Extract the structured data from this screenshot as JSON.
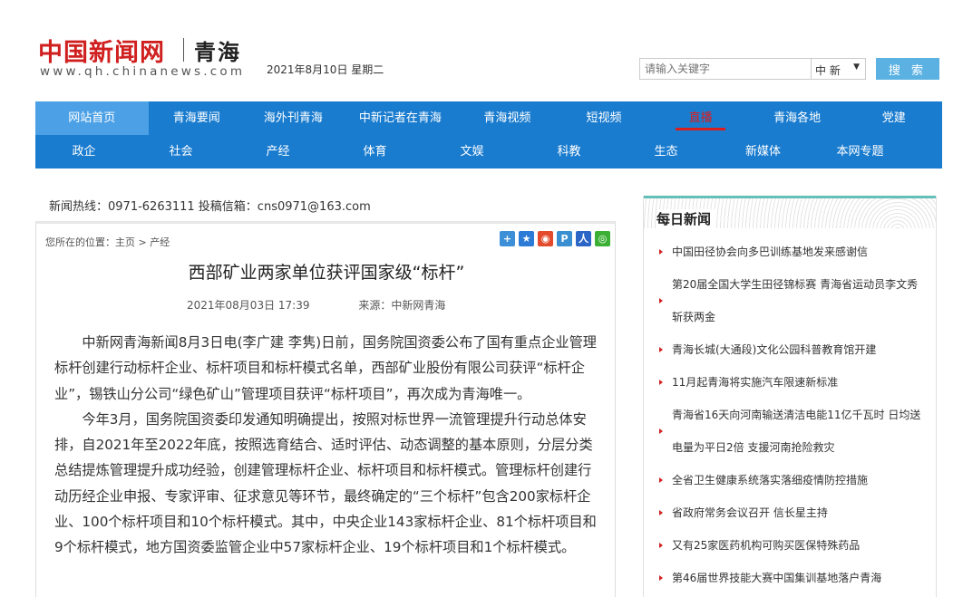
{
  "header": {
    "logo_cn": "中国新闻网",
    "logo_region": "青海",
    "logo_url": "www.qh.chinanews.com",
    "date": "2021年8月10日 星期二",
    "search_placeholder": "请输入关键字",
    "search_select": "中 新",
    "search_button": "搜 索"
  },
  "nav": {
    "row1": [
      "网站首页",
      "青海要闻",
      "海外刊青海",
      "中新记者在青海",
      "青海视频",
      "短视频",
      "直播",
      "青海各地",
      "党建"
    ],
    "row2": [
      "政企",
      "社会",
      "产经",
      "体育",
      "文娱",
      "科教",
      "生态",
      "新媒体",
      "本网专题"
    ]
  },
  "hotline": "新闻热线：0971-6263111 投稿信箱：cns0971@163.com",
  "article": {
    "breadcrumb": "您所在的位置：主页 > 产经",
    "title": "西部矿业两家单位获评国家级“标杆”",
    "datetime": "2021年08月03日 17:39",
    "source": "来源：中新网青海",
    "paragraphs": [
      "中新网青海新闻8月3日电(李广建 李隽)日前，国务院国资委公布了国有重点企业管理标杆创建行动标杆企业、标杆项目和标杆模式名单，西部矿业股份有限公司获评“标杆企业”，锡铁山分公司“绿色矿山”管理项目获评“标杆项目”，再次成为青海唯一。",
      "今年3月，国务院国资委印发通知明确提出，按照对标世界一流管理提升行动总体安排，自2021年至2022年底，按照选育结合、适时评估、动态调整的基本原则，分层分类总结提炼管理提升成功经验，创建管理标杆企业、标杆项目和标杆模式。管理标杆创建行动历经企业申报、专家评审、征求意见等环节，最终确定的“三个标杆”包含200家标杆企业、100个标杆项目和10个标杆模式。其中，中央企业143家标杆企业、81个标杆项目和9个标杆模式，地方国资委监管企业中57家标杆企业、19个标杆项目和1个标杆模式。"
    ]
  },
  "sidebar": {
    "title": "每日新闻",
    "items": [
      "中国田径协会向多巴训练基地发来感谢信",
      "第20届全国大学生田径锦标赛 青海省运动员李文秀 斩获两金",
      "青海长城(大通段)文化公园科普教育馆开建",
      "11月起青海将实施汽车限速新标准",
      "青海省16天向河南输送清洁电能11亿千瓦时 日均送 电量为平日2倍 支援河南抢险救灾",
      "全省卫生健康系统落实落细疫情防控措施",
      "省政府常务会议召开 信长星主持",
      "又有25家医药机构可购买医保特殊药品",
      "第46届世界技能大赛中国集训基地落户青海"
    ]
  },
  "colors": {
    "brand_red": "#d01f1f",
    "nav_blue": "#1a7ccf",
    "nav_active": "#4ba0e6",
    "search_btn": "#5cb1e3",
    "sidebar_accent": "#63bfb7"
  }
}
